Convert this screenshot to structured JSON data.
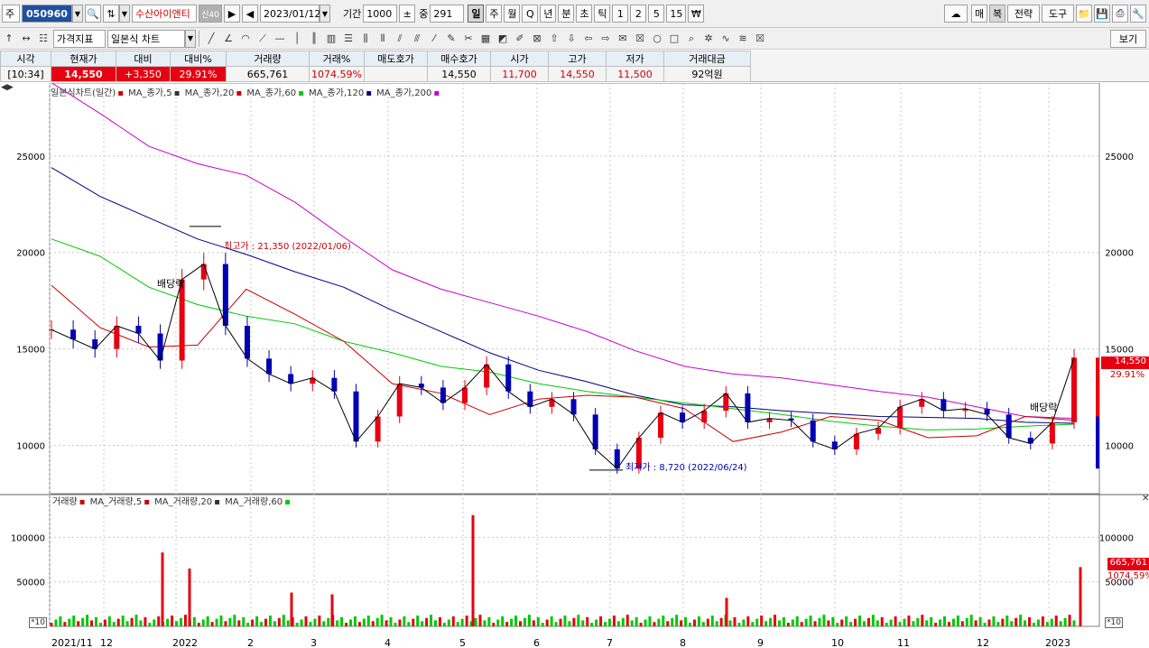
{
  "toolbar1": {
    "market": "주",
    "code": "050960",
    "stock_name": "수산아이앤티",
    "badge": "신40",
    "date": "2023/01/12",
    "period_label": "기간",
    "period_value": "1000",
    "count_label": "중",
    "count_value": "291",
    "periods": [
      "일",
      "주",
      "월",
      "Q",
      "년",
      "분",
      "초",
      "틱",
      "1",
      "2",
      "5",
      "15",
      "₩"
    ],
    "right_buttons": [
      "매",
      "복",
      "전략",
      "도구"
    ]
  },
  "toolbar2": {
    "price_indicator": "가격지표",
    "chart_type": "일본식 차트",
    "view_button": "보기"
  },
  "quote": {
    "headers": [
      "시각",
      "현재가",
      "대비",
      "대비%",
      "거래량",
      "거래%",
      "매도호가",
      "매수호가",
      "시가",
      "고가",
      "저가",
      "거래대금"
    ],
    "values": [
      "[10:34]",
      "14,550",
      "+3,350",
      "29.91%",
      "665,761",
      "1074.59%",
      "",
      "14,550",
      "11,700",
      "14,550",
      "11,500",
      "92억원"
    ]
  },
  "price_legend": [
    "일본식차트(일간)",
    "MA_종가,5",
    "MA_종가,20",
    "MA_종가,60",
    "MA_종가,120",
    "MA_종가,200"
  ],
  "volume_legend": [
    "거래량",
    "MA_거래량,5",
    "MA_거래량,20",
    "MA_거래량,60"
  ],
  "annotations": {
    "high": "최고가 : 21,350 (2022/01/06)",
    "low": "최저가 : 8,720 (2022/06/24)",
    "dividend": "배당락",
    "last_price": "14,550",
    "last_change": "29.91%",
    "last_volume": "665,761",
    "last_volume_pct": "1074.59%",
    "x10": "*10"
  },
  "colors": {
    "up": "#e60012",
    "down": "#0000b4",
    "ma5": "#000000",
    "ma20": "#c80000",
    "ma60": "#00c800",
    "ma120": "#000080",
    "ma200": "#c800c8"
  },
  "chart_data": [
    {
      "type": "candlestick",
      "title": "일본식차트(일간)",
      "yticks": [
        10000,
        15000,
        20000,
        25000
      ],
      "ylim": [
        7500,
        28500
      ],
      "xticks": [
        "2021/11",
        "12",
        "2022",
        "2",
        "3",
        "4",
        "5",
        "6",
        "7",
        "8",
        "9",
        "10",
        "11",
        "12",
        "2023"
      ],
      "series": [
        {
          "name": "MA_종가,5"
        },
        {
          "name": "MA_종가,20"
        },
        {
          "name": "MA_종가,60"
        },
        {
          "name": "MA_종가,120"
        },
        {
          "name": "MA_종가,200"
        }
      ],
      "ma200": [
        28800,
        27200,
        25500,
        24600,
        24000,
        22600,
        20800,
        19100,
        18100,
        17400,
        16700,
        15900,
        14900,
        14100,
        13700,
        13500,
        13150,
        12800,
        12500,
        12000,
        11500,
        11400
      ],
      "ma120": [
        24400,
        22900,
        21800,
        20700,
        19900,
        19000,
        18200,
        17000,
        15900,
        14800,
        13900,
        13300,
        12600,
        12100,
        12000,
        11800,
        11650,
        11500,
        11450,
        11400,
        11200,
        11150
      ],
      "ma60": [
        20700,
        19800,
        18200,
        17300,
        16700,
        16300,
        15400,
        14800,
        14100,
        13800,
        13200,
        12800,
        12500,
        12200,
        11900,
        11600,
        11250,
        11000,
        10800,
        10850,
        11000,
        11100
      ],
      "ma20": [
        18300,
        16100,
        15100,
        15200,
        18100,
        16800,
        15400,
        13200,
        12700,
        11600,
        12400,
        12600,
        12500,
        11900,
        10200,
        10700,
        11500,
        11300,
        10400,
        10500,
        11500,
        11300
      ],
      "closes": [
        16000,
        15500,
        15000,
        16200,
        15800,
        14400,
        18600,
        19400,
        16200,
        14500,
        13700,
        13200,
        13500,
        12800,
        10200,
        11500,
        13200,
        13000,
        12200,
        13000,
        14200,
        12800,
        12000,
        12400,
        11600,
        9800,
        8800,
        10400,
        11700,
        11200,
        11800,
        12700,
        11200,
        11400,
        11300,
        10200,
        9800,
        10600,
        10900,
        12000,
        12400,
        11800,
        11900,
        11600,
        10400,
        10100,
        11200,
        14550
      ]
    },
    {
      "type": "bar",
      "title": "거래량",
      "yticks": [
        50000,
        100000
      ],
      "ylim": [
        0,
        140000
      ],
      "spikes": [
        {
          "x": "2021/12",
          "value": 83000
        },
        {
          "x": "2022/01/06",
          "value": 65000
        },
        {
          "x": "2022/03",
          "value": 38000
        },
        {
          "x": "2022/04",
          "value": 36000
        },
        {
          "x": "2022/05",
          "value": 125000
        },
        {
          "x": "2022/08",
          "value": 32000
        },
        {
          "x": "2023/01/12",
          "value": 66576
        }
      ]
    }
  ]
}
